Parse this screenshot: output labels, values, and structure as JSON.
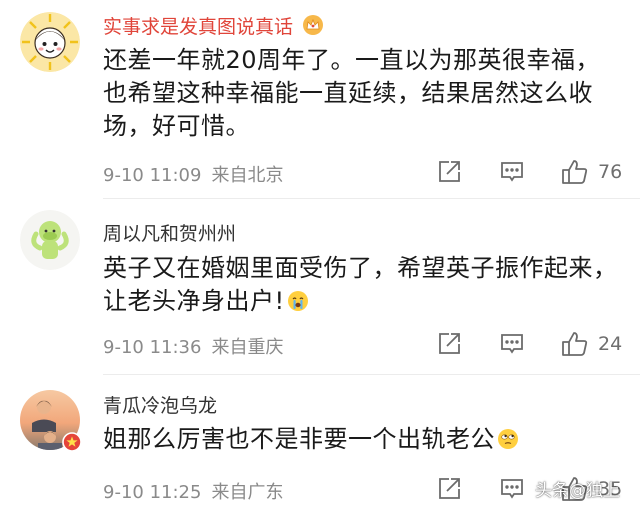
{
  "colors": {
    "username_highlight": "#e0453a",
    "username_normal": "#333333",
    "meta_gray": "#8a8a8a",
    "icon_gray": "#6b6b6b"
  },
  "comments": [
    {
      "username": "实事求是发真图说真话",
      "username_highlighted": true,
      "badge_icon": "crown-badge-icon",
      "text": "还差一年就20周年了。一直以为那英很幸福，也希望这种幸福能一直延续，结果居然这么收场，好可惜。",
      "time": "9-10 11:09",
      "location": "来自北京",
      "likes": "76"
    },
    {
      "username": "周以凡和贺州州",
      "username_highlighted": false,
      "text": "英子又在婚姻里面受伤了，希望英子振作起来，让老头净身出户!",
      "text_emoji": "crying-face-icon",
      "time": "9-10 11:36",
      "location": "来自重庆",
      "likes": "24"
    },
    {
      "username": "青瓜冷泡乌龙",
      "username_highlighted": false,
      "text": "姐那么厉害也不是非要一个出轨老公",
      "text_emoji": "rolling-eyes-face-icon",
      "time": "9-10 11:25",
      "location": "来自广东",
      "likes": "35"
    }
  ],
  "watermark": "头条@独上"
}
